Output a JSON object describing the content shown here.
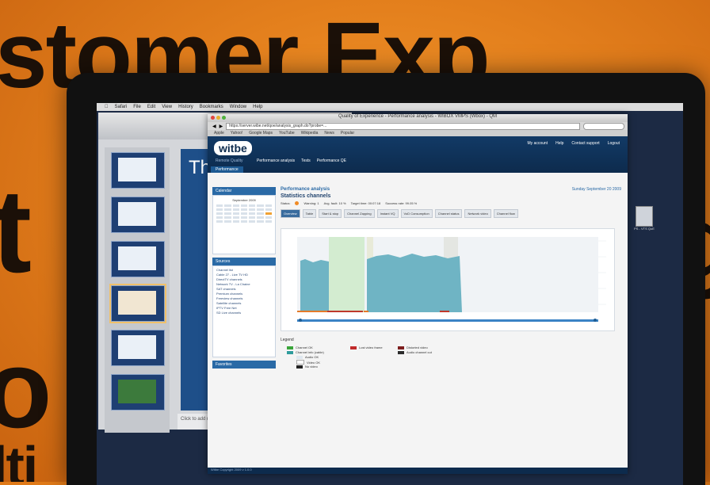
{
  "poster": {
    "line1": "stomer Exp",
    "line2": "t",
    "line3": "o",
    "line4": "lti",
    "right1": "g",
    "right2": "r"
  },
  "mac_menu": [
    "Safari",
    "File",
    "Edit",
    "View",
    "History",
    "Bookmarks",
    "Window",
    "Help"
  ],
  "ppt": {
    "slide_title": "Th",
    "bottom_text": "Click to add notes"
  },
  "browser": {
    "title": "Quality of Experience - Performance analysis - WIBOX VMPS (Wbox) - QM",
    "url": "https://server.wibe.net/qoe/analysis_graph.do?probe=...",
    "bookmarks": [
      "Apple",
      "Yahoo!",
      "Google Maps",
      "YouTube",
      "Wikipedia",
      "News",
      "Popular"
    ]
  },
  "app": {
    "logo": "witbe",
    "logo_sub": "Remote Quality",
    "crumbs": [
      "Performance analysis",
      "Tests",
      "Performance QE"
    ],
    "header_links": [
      "My account",
      "Help",
      "Contact support",
      "Logout"
    ],
    "sub_tab": "Performance"
  },
  "left": {
    "calendar_title": "Calendar",
    "calendar_month": "September 2009",
    "sources_title": "Sources",
    "sources": [
      "Channel list",
      "Cable 27 - Live TV HD",
      "DirectTV channels",
      "Network TV - La Chaine",
      "SAT channels",
      "Premium channels",
      "Freeview channels",
      "Satellite channels",
      "IPTV Free Net",
      "SD Live channels"
    ],
    "favorites_title": "Favorites"
  },
  "main": {
    "title": "Performance analysis",
    "subtitle": "Statistics channels",
    "date": "Sunday September 20 2009",
    "status_label": "Status:",
    "status_items": [
      "Warning: 1",
      "Avg. fault: 10 %",
      "Target time: 00:07:18",
      "Success rate: 99.05 %"
    ],
    "tabs": [
      "Overview",
      "Table",
      "Start & stop",
      "Channel Zapping",
      "Instant VQ",
      "VoD Consumption",
      "Channel status",
      "Network video",
      "Channel flow"
    ],
    "legend_title": "Legend",
    "legend": [
      {
        "label": "Channel OK",
        "color": "#3aa53a"
      },
      {
        "label": "Channel info (cable)",
        "color": "#2e9c9c"
      },
      {
        "label": "Audio OK",
        "color": "#dfe7ef"
      },
      {
        "label": "Video OK",
        "color": "#ffffff"
      },
      {
        "label": "No video",
        "color": "#222222"
      },
      {
        "label": "Lost video frame",
        "color": "#c02a2a"
      },
      {
        "label": "Distorted video",
        "color": "#7d1e1e"
      },
      {
        "label": "Audio channel cut",
        "color": "#2b2b2b"
      }
    ],
    "footer": "Witbe Copyright 2009 v 1.0.0"
  },
  "desktop_icon_label": "PS - VTS QoE"
}
